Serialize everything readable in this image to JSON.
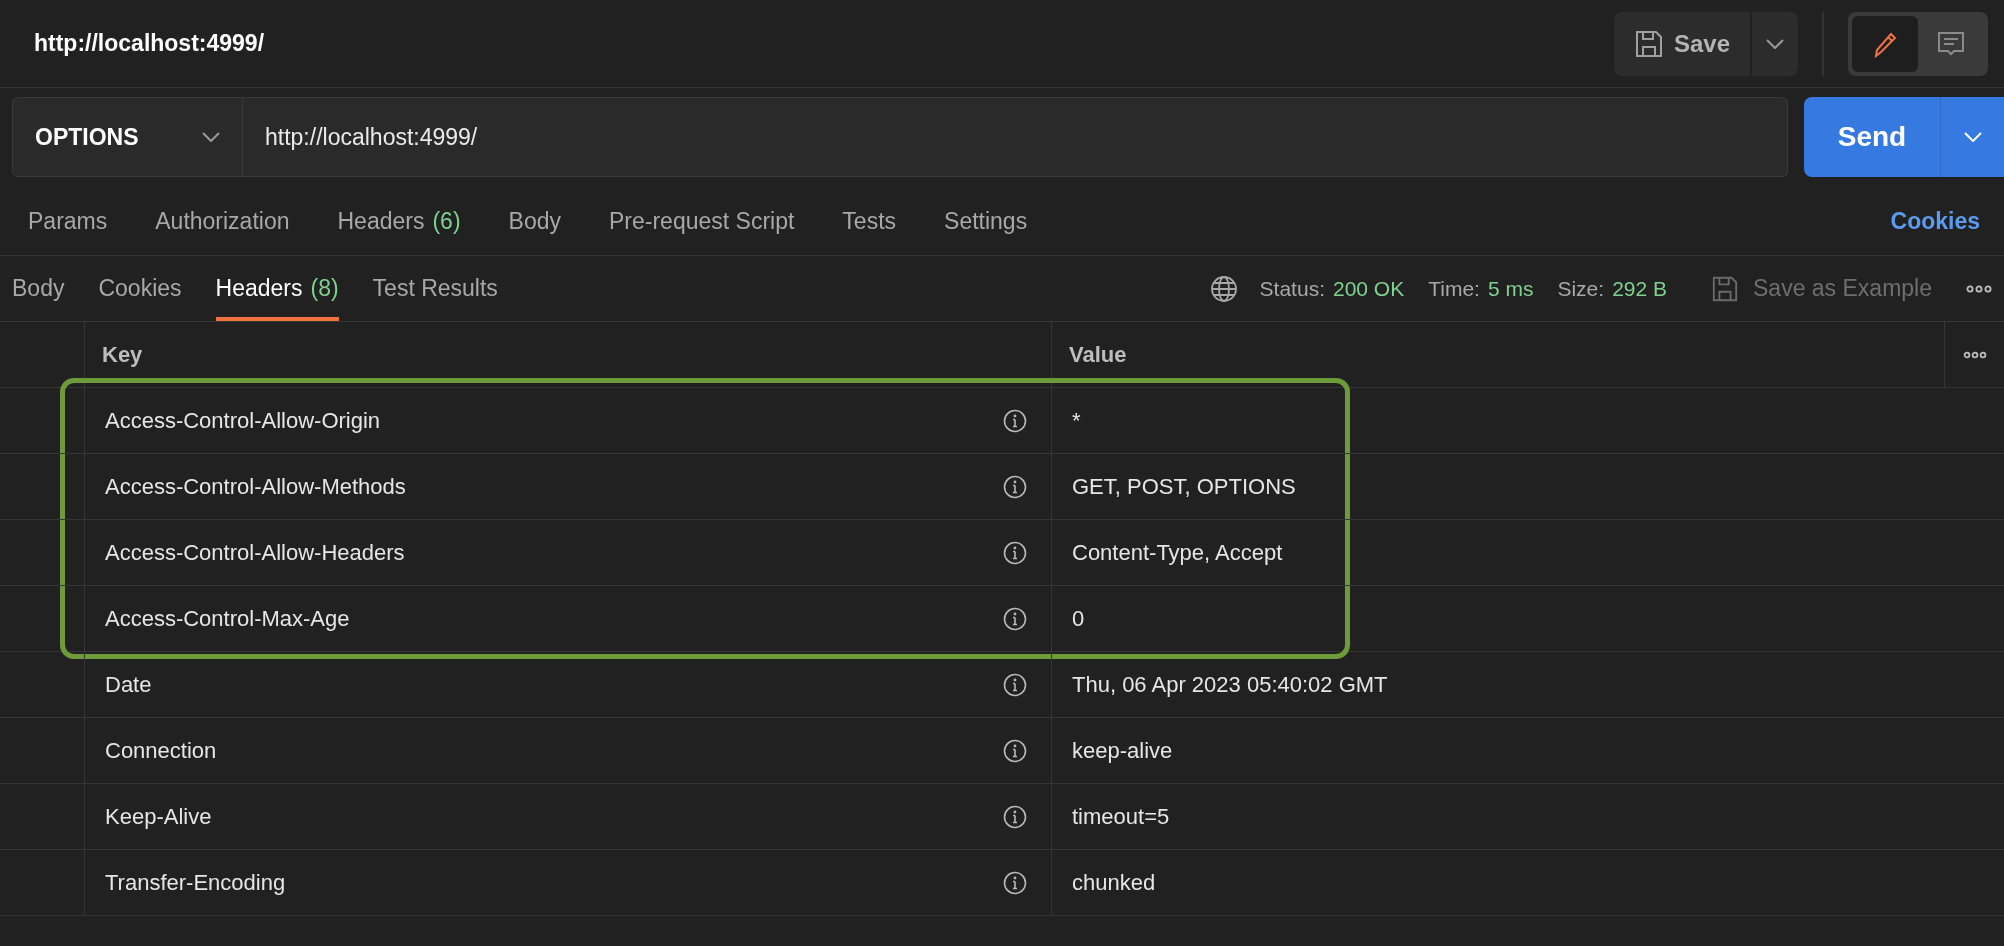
{
  "header": {
    "title": "http://localhost:4999/",
    "save_label": "Save",
    "mode_toggle": [
      {
        "kind": "edit",
        "selected": true
      },
      {
        "kind": "comments",
        "selected": false
      }
    ]
  },
  "request": {
    "method": "OPTIONS",
    "url": "http://localhost:4999/",
    "send_label": "Send"
  },
  "request_tabs": [
    {
      "label": "Params",
      "selected": false
    },
    {
      "label": "Authorization",
      "selected": false
    },
    {
      "label": "Headers",
      "count": "(6)",
      "selected": false
    },
    {
      "label": "Body",
      "selected": false
    },
    {
      "label": "Pre-request Script",
      "selected": false
    },
    {
      "label": "Tests",
      "selected": false
    },
    {
      "label": "Settings",
      "selected": false
    }
  ],
  "cookies_link": "Cookies",
  "response_tabs": [
    {
      "label": "Body",
      "selected": false
    },
    {
      "label": "Cookies",
      "selected": false
    },
    {
      "label": "Headers",
      "count": "(8)",
      "selected": true
    },
    {
      "label": "Test Results",
      "selected": false
    }
  ],
  "response_meta": {
    "status_label": "Status:",
    "status": "200 OK",
    "time_label": "Time:",
    "time": "5 ms",
    "size_label": "Size:",
    "size": "292 B",
    "save_example": "Save as Example"
  },
  "table": {
    "columns": [
      "Key",
      "Value"
    ],
    "rows": [
      {
        "key": "Access-Control-Allow-Origin",
        "value": "*",
        "highlighted": true
      },
      {
        "key": "Access-Control-Allow-Methods",
        "value": "GET, POST, OPTIONS",
        "highlighted": true
      },
      {
        "key": "Access-Control-Allow-Headers",
        "value": "Content-Type, Accept",
        "highlighted": true
      },
      {
        "key": "Access-Control-Max-Age",
        "value": "0",
        "highlighted": true
      },
      {
        "key": "Date",
        "value": "Thu, 06 Apr 2023 05:40:02 GMT",
        "highlighted": false
      },
      {
        "key": "Connection",
        "value": "keep-alive",
        "highlighted": false
      },
      {
        "key": "Keep-Alive",
        "value": "timeout=5",
        "highlighted": false
      },
      {
        "key": "Transfer-Encoding",
        "value": "chunked",
        "highlighted": false
      }
    ]
  }
}
